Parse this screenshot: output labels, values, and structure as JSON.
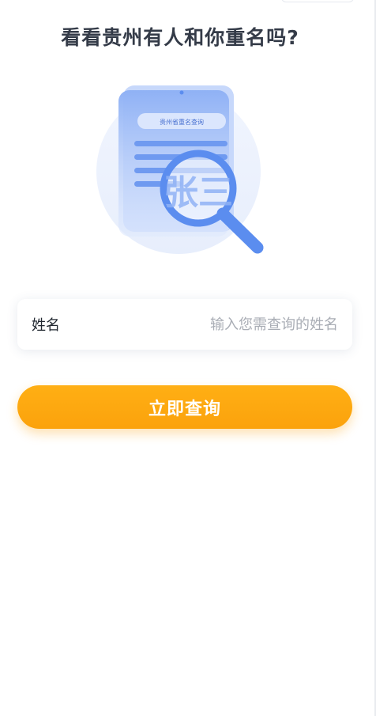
{
  "header": {
    "title": "看看贵州有人和你重名吗?"
  },
  "illustration": {
    "doc_title": "贵州省重名查询",
    "sample_name": "张三",
    "icons": [
      "document-icon",
      "magnifier-icon"
    ],
    "colors": {
      "circle_bg": "#eef3fd",
      "document": "#8fb1f5",
      "magnifier": "#5b8def"
    }
  },
  "form": {
    "name_label": "姓名",
    "name_value": "",
    "name_placeholder": "输入您需查询的姓名"
  },
  "actions": {
    "query_label": "立即查询"
  },
  "theme": {
    "accent": "#fba20c",
    "title_color": "#343b48",
    "placeholder_color": "#a9adb5"
  }
}
